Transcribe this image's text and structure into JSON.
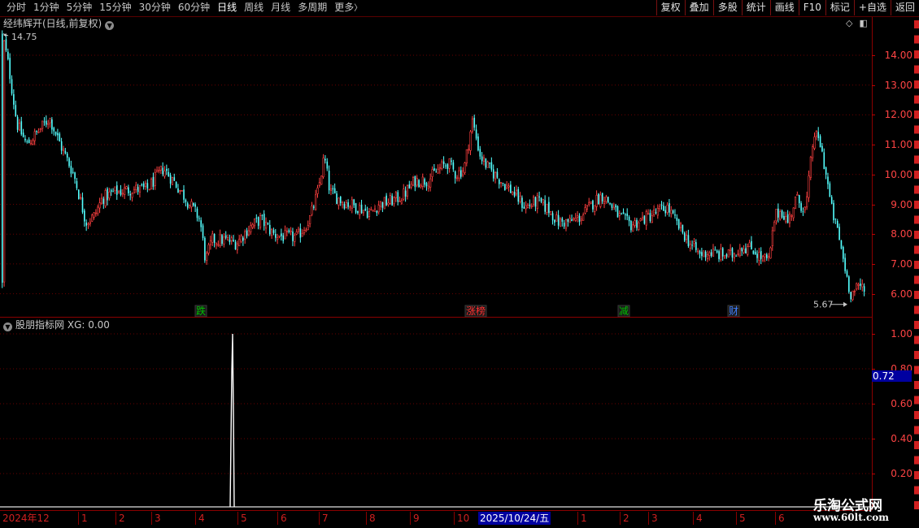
{
  "toolbar": {
    "periods": [
      "分时",
      "1分钟",
      "5分钟",
      "15分钟",
      "30分钟",
      "60分钟",
      "日线",
      "周线",
      "月线",
      "多周期",
      "更多"
    ],
    "active_period": "日线",
    "more_arrow": "〉",
    "buttons": [
      "复权",
      "叠加",
      "多股",
      "统计",
      "画线",
      "F10",
      "标记",
      "+自选",
      "返回"
    ]
  },
  "main_panel": {
    "title": "经纬辉开(日线,前复权)",
    "title_icon": "chevron-down-icon",
    "y_ticks": [
      "14.00",
      "13.00",
      "12.00",
      "11.00",
      "10.00",
      "9.00",
      "8.00",
      "7.00",
      "6.00"
    ],
    "high_label": "14.75",
    "low_label": "5.67",
    "event_markers": [
      {
        "text": "跌",
        "color": "#00c000"
      },
      {
        "text": "涨榜",
        "color": "#ff3030"
      },
      {
        "text": "减",
        "color": "#00c000"
      },
      {
        "text": "财",
        "color": "#4080ff"
      }
    ]
  },
  "indicator_panel": {
    "title": "股朋指标网",
    "value_label": "XG: 0.00",
    "y_ticks": [
      "1.00",
      "0.80",
      "0.60",
      "0.40",
      "0.20"
    ],
    "current_value": "0.72",
    "signal_bar_value": 1.0
  },
  "x_axis": {
    "labels": [
      "2024年12",
      "1",
      "2",
      "3",
      "4",
      "5",
      "6",
      "7",
      "8",
      "9",
      "10",
      "1",
      "2",
      "3",
      "4",
      "5",
      "6"
    ],
    "selected_date": "2025/10/24/五"
  },
  "watermark": {
    "line1": "乐淘公式网",
    "line2": "www.60lt.com"
  },
  "colors": {
    "up": "#ff4040",
    "down": "#54ffff",
    "axis_red": "#c00000",
    "select_blue": "#0000a0"
  }
}
